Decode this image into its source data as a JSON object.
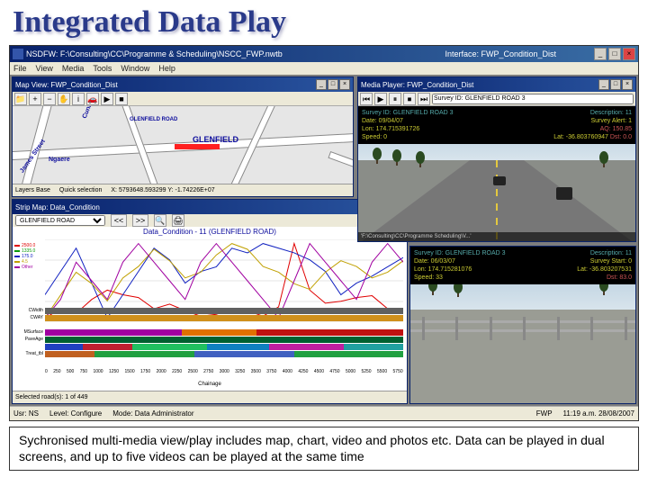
{
  "slide": {
    "title": "Integrated Data Play"
  },
  "app": {
    "titlebar": "NSDFW: F:\\Consulting\\CC\\Programme & Scheduling\\NSCC_FWP.nwtb",
    "interface_label": "Interface: FWP_Condition_Dist",
    "menu": [
      "File",
      "View",
      "Media",
      "Tools",
      "Window",
      "Help"
    ],
    "statusbar": {
      "user": "Usr: NS",
      "level": "Level: Configure",
      "mode": "Mode: Data Administrator",
      "fwp": "FWP",
      "time": "11:19 a.m. 28/08/2007"
    }
  },
  "map": {
    "title": "Map View: FWP_Condition_Dist",
    "labels": {
      "glenfield": "GLENFIELD",
      "glenfield_rd": "GLENFIELD ROAD",
      "cunningham": "Cunningham",
      "james": "James Street",
      "ngaere": "Ngaere"
    },
    "footer": {
      "layer": "Layers Base",
      "sel": "Quick selection",
      "scale": "X: 5793648.593299  Y: -1.74226E+07"
    }
  },
  "strip": {
    "title": "Strip Map: Data_Condition",
    "road_sel": "GLENFIELD ROAD",
    "toolbar_labels": [
      "<<",
      ">>"
    ],
    "chart_title": "Data_Condition - 11 (GLENFIELD ROAD)",
    "xaxis_label": "Chainage",
    "footer": "Selected road(s): 1 of 449"
  },
  "chart_data": {
    "type": "line",
    "x": [
      0,
      250,
      500,
      750,
      1000,
      1250,
      1500,
      1750,
      2000,
      2250,
      2500,
      2750,
      3000,
      3250,
      3500,
      3750,
      4000,
      4250,
      4500,
      4750,
      5000,
      5250,
      5500,
      5750
    ],
    "series": [
      {
        "name": "2500.0",
        "color": "#e00000",
        "values": [
          600,
          700,
          650,
          800,
          900,
          850,
          820,
          700,
          750,
          680,
          620,
          640,
          700,
          680,
          620,
          720,
          1400,
          900,
          760,
          780,
          820,
          840,
          700,
          650
        ]
      },
      {
        "name": "1335.0",
        "color": "#0a9a0a",
        "values": [
          1335,
          1335,
          1335,
          1335,
          1335,
          1335,
          1335,
          1335,
          1335,
          1335,
          1335,
          1335,
          1335,
          1335,
          1335,
          1335,
          1335,
          1335,
          1335,
          1335,
          1335,
          1335,
          1335,
          1335
        ]
      },
      {
        "name": "175.0",
        "color": "#1020c0",
        "values": [
          150,
          160,
          170,
          155,
          140,
          150,
          160,
          170,
          165,
          155,
          160,
          162,
          170,
          168,
          172,
          170,
          168,
          165,
          160,
          150,
          155,
          158,
          162,
          166
        ]
      },
      {
        "name": "4.5",
        "color": "#c0a000",
        "values": [
          3.2,
          3.6,
          4.0,
          3.8,
          3.5,
          3.9,
          4.1,
          4.4,
          4.2,
          3.9,
          4.0,
          4.3,
          4.5,
          4.4,
          4.1,
          4.0,
          3.8,
          3.7,
          4.0,
          4.2,
          4.1,
          3.9,
          4.0,
          4.2
        ]
      },
      {
        "name": "Other",
        "color": "#a000a0",
        "values": [
          0.12,
          0.13,
          0.15,
          0.14,
          0.13,
          0.15,
          0.16,
          0.15,
          0.14,
          0.13,
          0.15,
          0.16,
          0.15,
          0.14,
          0.13,
          0.12,
          0.14,
          0.16,
          0.15,
          0.14,
          0.13,
          0.15,
          0.16,
          0.15
        ]
      }
    ],
    "ylim": [
      0,
      2500
    ],
    "bands": [
      {
        "name": "CWidth",
        "segs": [
          {
            "s": 0,
            "e": 5750,
            "c": "#606060"
          }
        ]
      },
      {
        "name": "CWAY",
        "segs": [
          {
            "s": 0,
            "e": 1600,
            "c": "#d0901c"
          },
          {
            "s": 1600,
            "e": 3000,
            "c": "#d0901c"
          },
          {
            "s": 3000,
            "e": 5750,
            "c": "#d0901c"
          }
        ]
      },
      {
        "name": "",
        "segs": []
      },
      {
        "name": "MSurface",
        "segs": [
          {
            "s": 0,
            "e": 2200,
            "c": "#a000a0"
          },
          {
            "s": 2200,
            "e": 3400,
            "c": "#e07000"
          },
          {
            "s": 3400,
            "e": 5750,
            "c": "#c01010"
          }
        ]
      },
      {
        "name": "PaveAge",
        "segs": [
          {
            "s": 0,
            "e": 5750,
            "c": "#006030"
          }
        ]
      },
      {
        "name": "",
        "segs": [
          {
            "s": 0,
            "e": 600,
            "c": "#2040c0"
          },
          {
            "s": 600,
            "e": 1400,
            "c": "#c02030"
          },
          {
            "s": 1400,
            "e": 2600,
            "c": "#20c060"
          },
          {
            "s": 2600,
            "e": 3600,
            "c": "#1080c0"
          },
          {
            "s": 3600,
            "e": 4800,
            "c": "#c020a0"
          },
          {
            "s": 4800,
            "e": 5750,
            "c": "#20a0a0"
          }
        ]
      },
      {
        "name": "Treat_tbl",
        "segs": [
          {
            "s": 0,
            "e": 800,
            "c": "#c06020"
          },
          {
            "s": 800,
            "e": 2400,
            "c": "#20a040"
          },
          {
            "s": 2400,
            "e": 4000,
            "c": "#4060c0"
          },
          {
            "s": 4000,
            "e": 5750,
            "c": "#20a040"
          }
        ]
      }
    ]
  },
  "video1": {
    "title": "Media Player: FWP_Condition_Dist",
    "overlay": {
      "survey": "Survey ID: GLENFIELD ROAD 3",
      "date": "Date: 09/04/07",
      "lon": "Lon: 174.715391726",
      "speed": "Speed: 0",
      "desc": "Description: 11",
      "alert": "Survey Alert: 1",
      "aq": "AQ: 150.85",
      "lat": "Lat: -36.803760947",
      "dist": "Dst: 0.0"
    },
    "footer": "'F:\\Consulting\\CC\\Programme Scheduling\\V...'"
  },
  "video2": {
    "overlay": {
      "survey": "Survey ID: GLENFIELD ROAD 3",
      "date": "Date: 06/03/07",
      "lon": "Lon: 174.715281076",
      "speed": "Speed: 33",
      "desc": "Description: 11",
      "start": "Survey Start: 0",
      "lat": "Lat: -36.803207531",
      "dist": "Dst: 83.0"
    }
  },
  "caption": "Sychronised multi-media view/play includes map, chart, video and photos etc. Data can be played in dual screens, and up to five videos can be played at the same time"
}
